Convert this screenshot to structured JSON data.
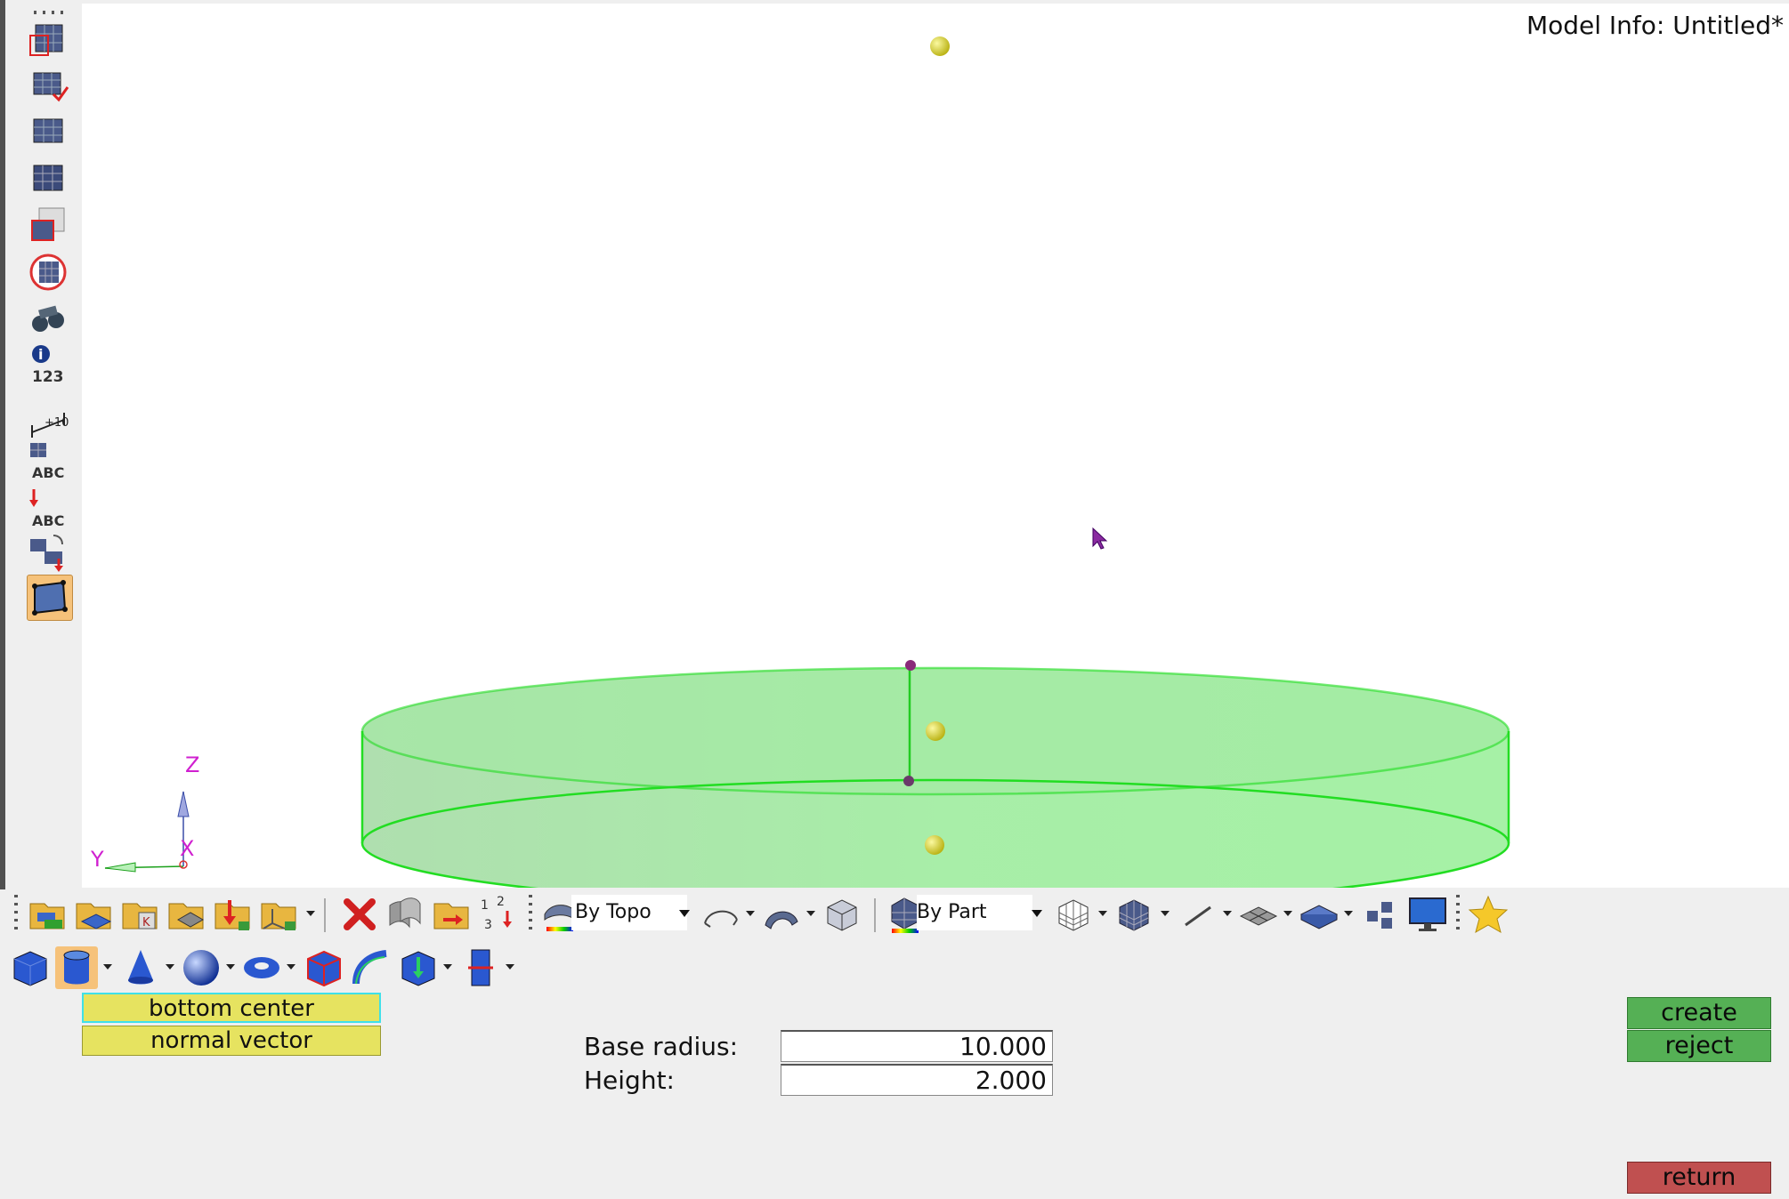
{
  "viewport": {
    "model_info": "Model Info: Untitled*",
    "triad": {
      "z": "Z",
      "y": "Y",
      "x": "X"
    }
  },
  "left_toolbar": {
    "icons": [
      "component-view-icon",
      "component-check-icon",
      "show-elements-icon",
      "mesh-icon",
      "find-icon",
      "isolate-icon",
      "binoculars-icon",
      "numbers-info-icon",
      "measure-icon",
      "abc-label-icon",
      "abc-load-icon",
      "organize-icon",
      "quick-edit-icon"
    ],
    "label_123": "123",
    "label_measure": "+10",
    "label_abc_1": "ABC",
    "label_abc_2": "ABC"
  },
  "toolbar1": {
    "topo_combo": "By Topo",
    "part_combo": "By Part"
  },
  "panel": {
    "bottom_center": "bottom center",
    "normal_vector": "normal vector",
    "base_radius_label": "Base radius:",
    "base_radius_value": "10.000",
    "height_label": "Height:",
    "height_value": "2.000",
    "create_label": "create",
    "reject_label": "reject",
    "return_label": "return"
  },
  "colors": {
    "cylinder_fill": "#8ee88e",
    "cylinder_edge": "#22dd22",
    "selected_tool": "#f6c27a",
    "yellow_button": "#e6e360",
    "green_button": "#55b055",
    "red_button": "#c05050"
  }
}
